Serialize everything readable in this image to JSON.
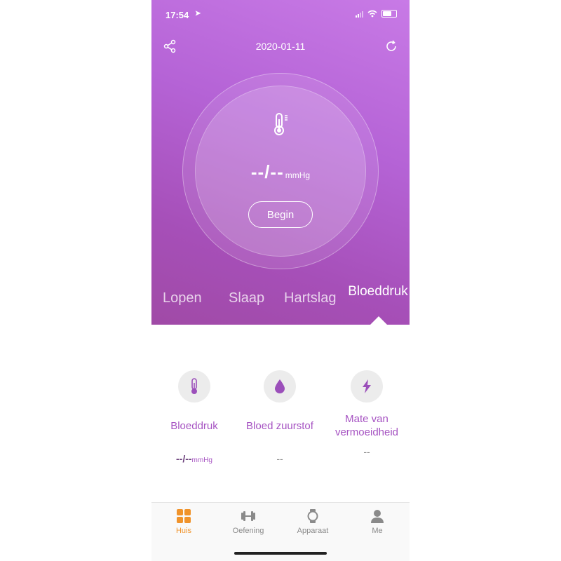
{
  "status_bar": {
    "time": "17:54",
    "location_glyph": "➤"
  },
  "header": {
    "date": "2020-01-11"
  },
  "measurement": {
    "value": "--/--",
    "unit": "mmHg",
    "begin_label": "Begin"
  },
  "tabs": [
    {
      "label": "Lopen"
    },
    {
      "label": "Slaap"
    },
    {
      "label": "Hartslag"
    },
    {
      "label": "Bloeddruk",
      "active": true
    }
  ],
  "metrics": [
    {
      "label": "Bloeddruk",
      "value": "--/--",
      "unit": "mmHg",
      "icon": "thermometer-icon"
    },
    {
      "label": "Bloed zuurstof",
      "value": "--",
      "icon": "drop-icon"
    },
    {
      "label": "Mate van vermoeidheid",
      "value": "--",
      "icon": "lightning-icon"
    }
  ],
  "tabbar": [
    {
      "label": "Huis",
      "icon": "grid-icon",
      "active": true
    },
    {
      "label": "Oefening",
      "icon": "dumbbell-icon"
    },
    {
      "label": "Apparaat",
      "icon": "watch-icon"
    },
    {
      "label": "Me",
      "icon": "person-icon"
    }
  ],
  "colors": {
    "accent": "#a653c2",
    "tabbar_active": "#f0932b",
    "hero_top": "#c87ae6",
    "hero_bottom": "#a04aa6"
  }
}
